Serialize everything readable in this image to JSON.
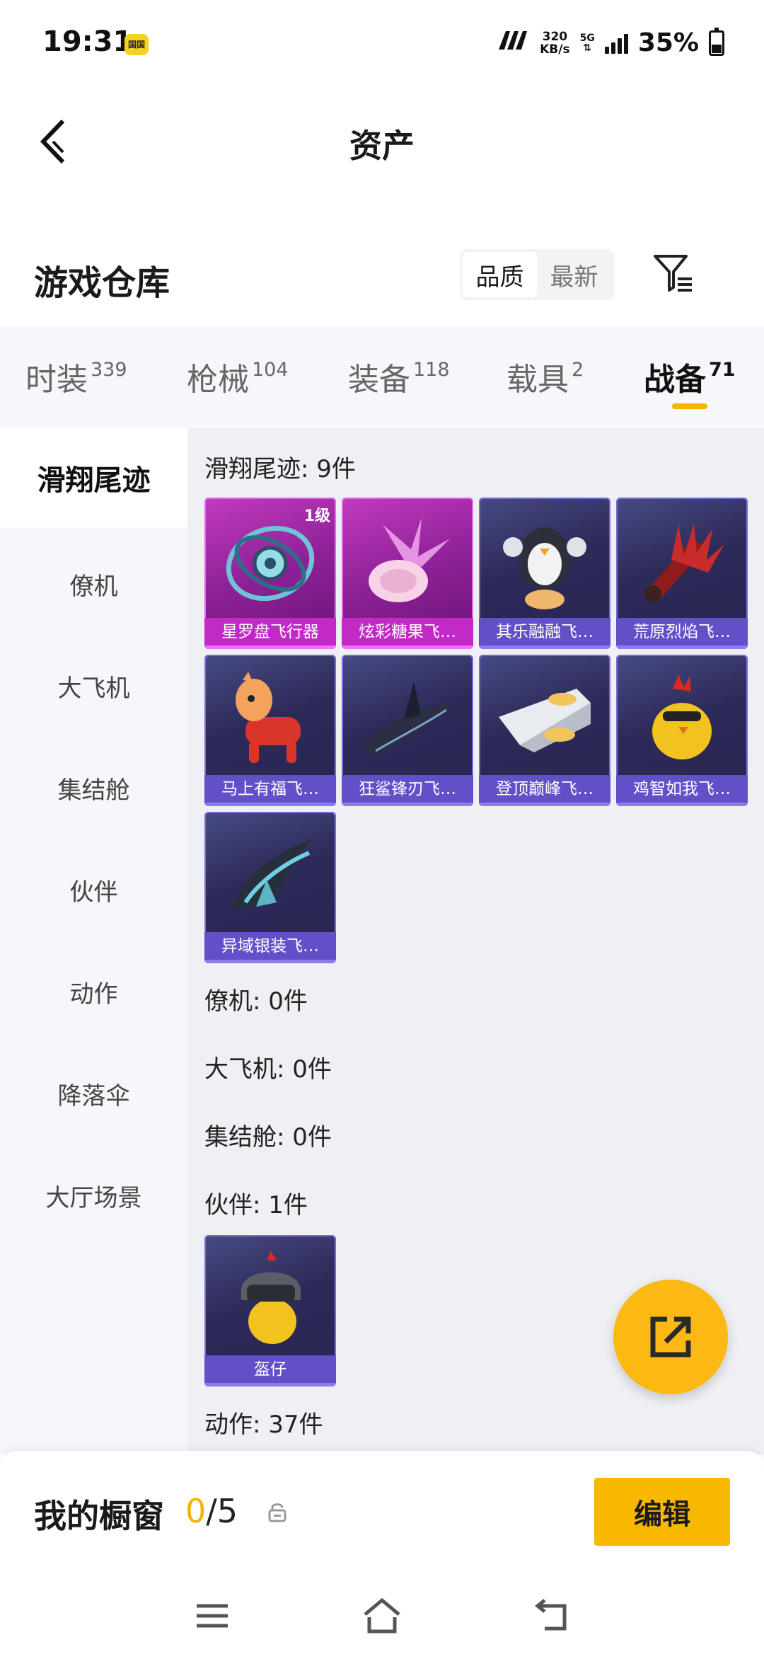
{
  "status_bar": {
    "time": "19:31",
    "badge": "国国",
    "network_brand": "7777",
    "speed_value": "320",
    "speed_unit": "KB/s",
    "network_type": "5G",
    "battery": "35%"
  },
  "header": {
    "title": "资产",
    "back_icon": "chevron-left-icon"
  },
  "warehouse": {
    "title": "游戏仓库",
    "sort_options": [
      "品质",
      "最新"
    ],
    "selected_sort": "品质",
    "filter_icon": "filter-icon"
  },
  "tabs": [
    {
      "label": "时装",
      "count": "339"
    },
    {
      "label": "枪械",
      "count": "104"
    },
    {
      "label": "装备",
      "count": "118"
    },
    {
      "label": "载具",
      "count": "2"
    },
    {
      "label": "战备",
      "count": "71",
      "active": true
    }
  ],
  "sidebar": {
    "items": [
      {
        "label": "滑翔尾迹",
        "active": true
      },
      {
        "label": "僚机"
      },
      {
        "label": "大飞机"
      },
      {
        "label": "集结舱"
      },
      {
        "label": "伙伴"
      },
      {
        "label": "动作"
      },
      {
        "label": "降落伞"
      },
      {
        "label": "大厅场景"
      }
    ]
  },
  "sections": {
    "glide_trail": {
      "label": "滑翔尾迹: 9件",
      "items": [
        {
          "name": "星罗盘飞行器",
          "level": "1级",
          "rarity": "pink"
        },
        {
          "name": "炫彩糖果飞…",
          "rarity": "pink"
        },
        {
          "name": "其乐融融飞…",
          "rarity": "purple"
        },
        {
          "name": "荒原烈焰飞…",
          "rarity": "purple"
        },
        {
          "name": "马上有福飞…",
          "rarity": "purple"
        },
        {
          "name": "狂鲨锋刃飞…",
          "rarity": "purple"
        },
        {
          "name": "登顶巅峰飞…",
          "rarity": "purple"
        },
        {
          "name": "鸡智如我飞…",
          "rarity": "purple"
        },
        {
          "name": "异域银装飞…",
          "rarity": "purple"
        }
      ]
    },
    "wingman": {
      "label": "僚机: 0件"
    },
    "airplane": {
      "label": "大飞机: 0件"
    },
    "assembly_pod": {
      "label": "集结舱: 0件"
    },
    "partner": {
      "label": "伙伴: 1件",
      "items": [
        {
          "name": "盔仔",
          "rarity": "purple"
        }
      ]
    },
    "action": {
      "label": "动作: 37件"
    }
  },
  "fab": {
    "icon": "share-external-icon"
  },
  "showcase": {
    "label": "我的橱窗",
    "current": "0",
    "total": "/5",
    "lock_icon": "lock-icon",
    "edit_label": "编辑"
  },
  "navbar": {
    "icons": [
      "menu-icon",
      "home-icon",
      "back-icon"
    ]
  },
  "colors": {
    "accent": "#f9b800",
    "pink_card": "#c12ac6",
    "purple_card": "#6250c9"
  }
}
